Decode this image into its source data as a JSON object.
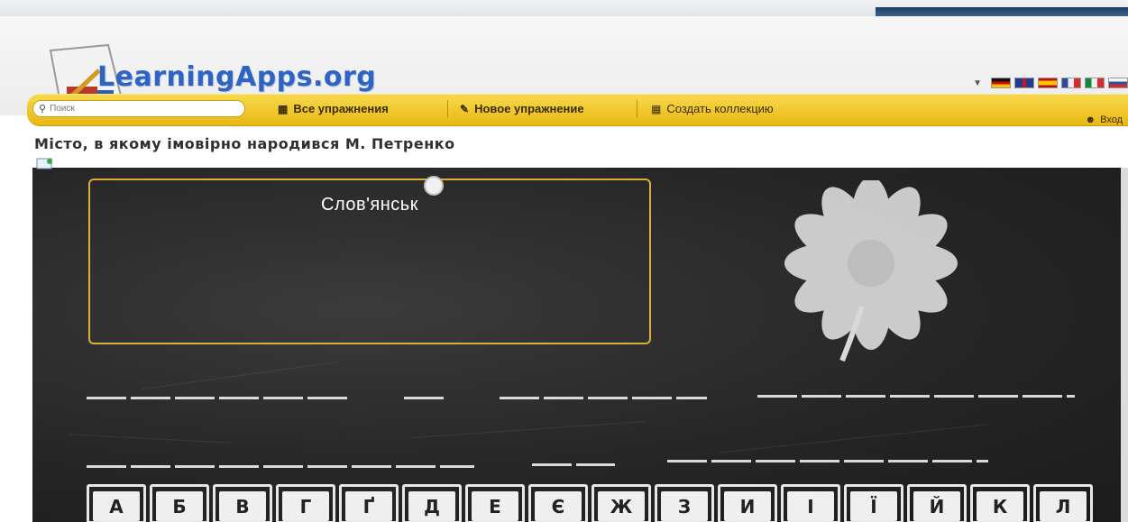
{
  "header": {
    "logo_text": "LearningApps.org",
    "languages": [
      "de",
      "en",
      "es",
      "fr",
      "it",
      "ru"
    ]
  },
  "toolbar": {
    "search_placeholder": "Поиск",
    "all_exercises_label": "Все упражнения",
    "new_exercise_label": "Новое упражнение",
    "create_collection_label": "Создать коллекцию",
    "login_label": "Вход"
  },
  "exercise": {
    "title": "Місто, в якому імовірно народився М. Петренко",
    "answer_text": "Слов'янськ",
    "letters": [
      "А",
      "Б",
      "В",
      "Г",
      "Ґ",
      "Д",
      "Е",
      "Є",
      "Ж",
      "З",
      "И",
      "І",
      "Ї",
      "Й",
      "К",
      "Л"
    ]
  },
  "colors": {
    "toolbar_yellow": "#f0c928",
    "logo_blue": "#2f64c4",
    "board_dark": "#262626",
    "frame_gold": "#e0ac3c"
  },
  "icons": {
    "search": "search-icon",
    "grid": "grid-icon",
    "pencil": "pencil-icon",
    "collection": "collection-icon",
    "user": "user-icon",
    "flower": "flower-drawing"
  }
}
